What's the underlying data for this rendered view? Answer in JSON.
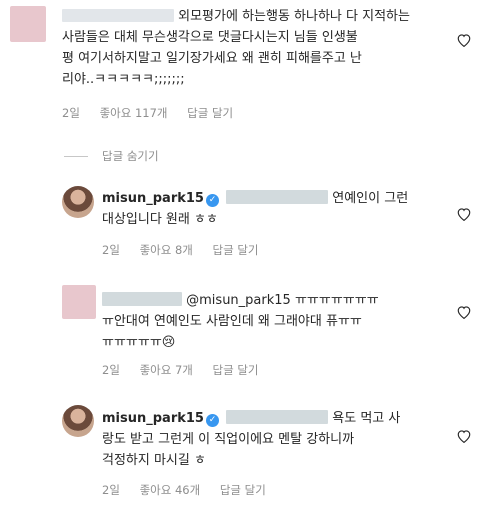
{
  "comments": [
    {
      "text_line1": "외모평가에 하는행동 하나하나 다 지적하는",
      "text_line2": "사람들은 대체 무슨생각으로 댓글다시는지 님들 인생불",
      "text_line3": "평 여기서하지말고 일기장가세요 왜 괜히 피해를주고 난",
      "text_line4": "리야..ㅋㅋㅋㅋㅋ;;;;;;;",
      "time": "2일",
      "likes": "좋아요 117개",
      "reply_label": "답글 달기"
    },
    {
      "username": "misun_park15",
      "text_part1": "연예인이 그런",
      "text_line2": "대상입니다 원래 ㅎㅎ",
      "time": "2일",
      "likes": "좋아요 8개",
      "reply_label": "답글 달기"
    },
    {
      "mention": "@misun_park15",
      "text_part1": "ㅠㅠㅠㅠㅠㅠㅠ",
      "text_line2": "ㅠ안대여 연예인도 사람인데 왜 그래야대 퓨ㅠㅠ",
      "text_line3": "ㅠㅠㅠㅠㅠ😢",
      "time": "2일",
      "likes": "좋아요 7개",
      "reply_label": "답글 달기"
    },
    {
      "username": "misun_park15",
      "text_part1": "욕도 먹고 사",
      "text_line2": "랑도 받고 그런게 이 직업이에요 멘탈 강하니까",
      "text_line3": "걱정하지 마시길 ㅎ",
      "time": "2일",
      "likes": "좋아요 46개",
      "reply_label": "답글 달기"
    }
  ],
  "hide_replies_label": "답글 숨기기",
  "icons": {
    "heart": "heart-icon",
    "verified": "verified-badge-icon"
  },
  "colors": {
    "meta": "#8e8e8e",
    "verified": "#3897f0"
  }
}
